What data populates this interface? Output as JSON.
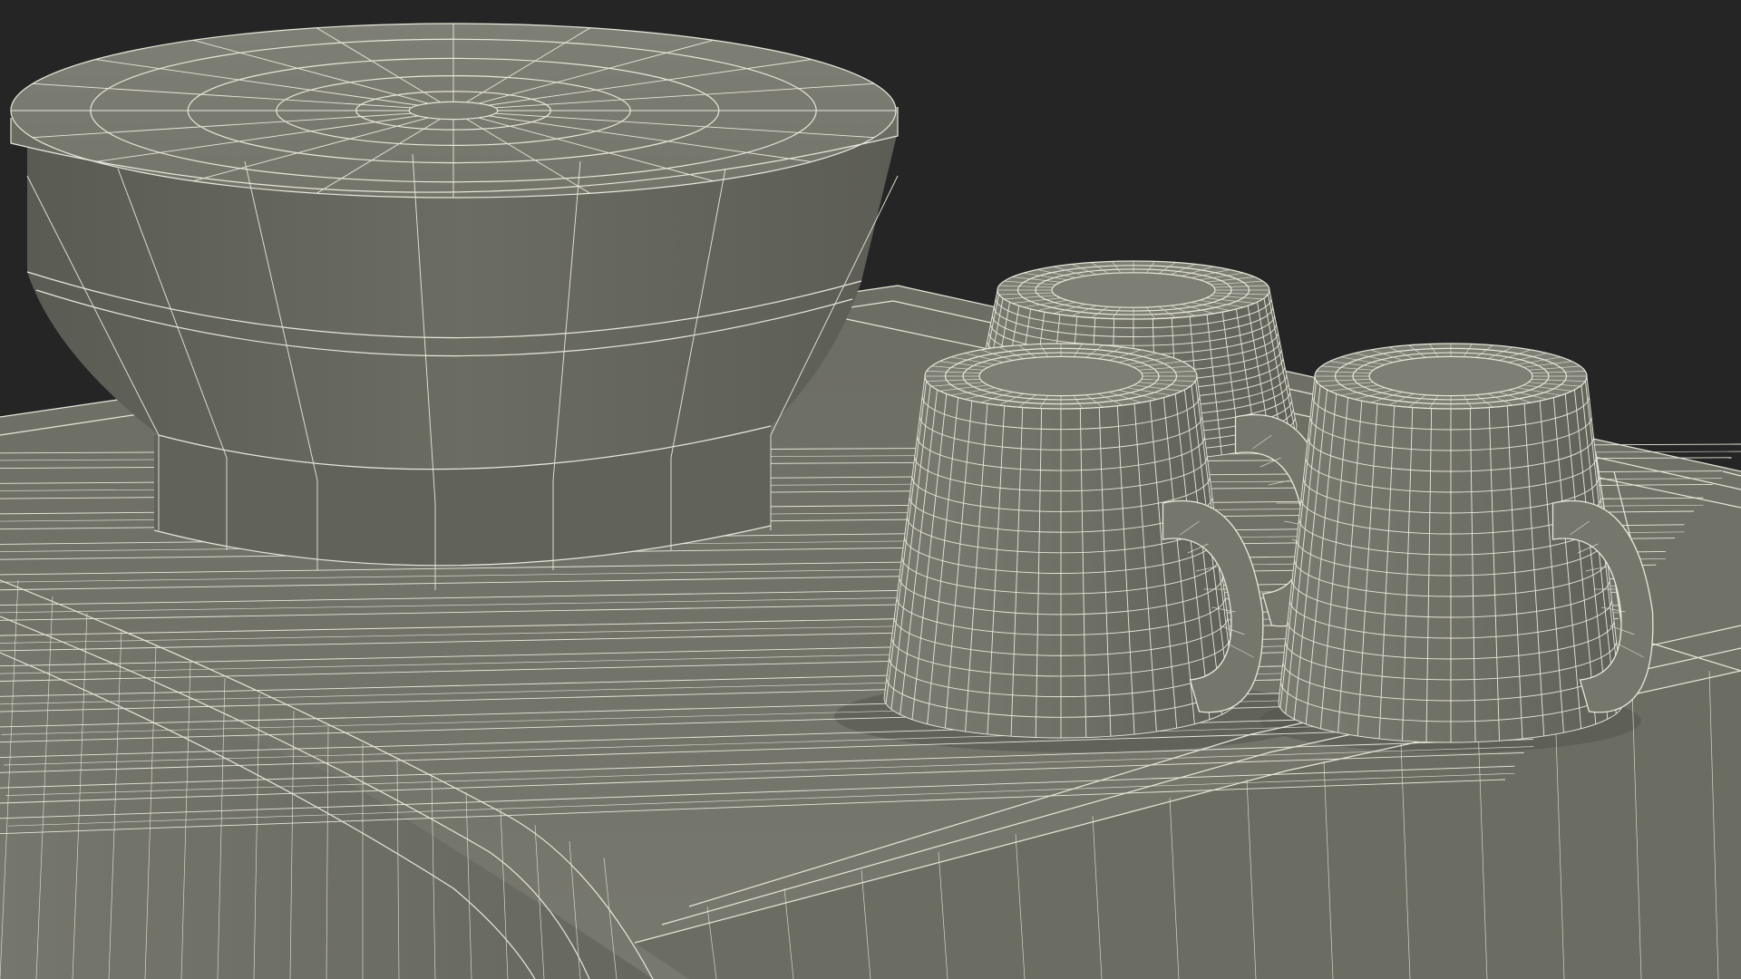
{
  "scene": {
    "background_color": "#252525",
    "model_color": "#6f7066",
    "model_shadow_color": "#5d5e55",
    "wire_color": "#e8e7dc",
    "objects": [
      "machine-top-tray",
      "container-with-lid",
      "cup-back",
      "cup-front-left",
      "cup-front-right"
    ]
  }
}
